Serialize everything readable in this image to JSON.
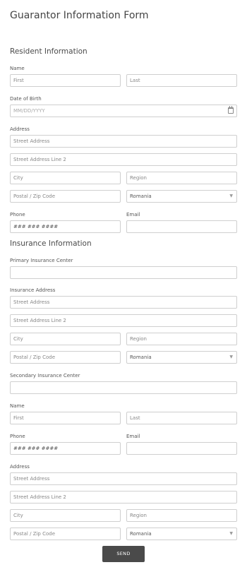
{
  "form": {
    "title": "Guarantor Information Form"
  },
  "resident": {
    "section_title": "Resident Information",
    "name_label": "Name",
    "first_placeholder": "First",
    "last_placeholder": "Last",
    "dob_label": "Date of Birth",
    "dob_placeholder": "MM/DD/YYYY",
    "address_label": "Address",
    "street_placeholder": "Street Address",
    "street2_placeholder": "Street Address Line 2",
    "city_placeholder": "City",
    "region_placeholder": "Region",
    "postal_placeholder": "Postal / Zip Code",
    "country_value": "Romania",
    "phone_label": "Phone",
    "phone_placeholder": "### ### ####",
    "email_label": "Email",
    "email_value": ""
  },
  "insurance": {
    "section_title": "Insurance Information",
    "primary_center_label": "Primary Insurance Center",
    "primary_center_value": "",
    "address_label": "Insurance Address",
    "street_placeholder": "Street Address",
    "street2_placeholder": "Street Address Line 2",
    "city_placeholder": "City",
    "region_placeholder": "Region",
    "postal_placeholder": "Postal / Zip Code",
    "country_value": "Romania",
    "secondary_center_label": "Secondary Insurance Center",
    "secondary_center_value": "",
    "name_label": "Name",
    "first_placeholder": "First",
    "last_placeholder": "Last",
    "phone_label": "Phone",
    "phone_placeholder": "### ### ####",
    "email_label": "Email",
    "email_value": "",
    "address2_label": "Address",
    "street_b_placeholder": "Street Address",
    "street2_b_placeholder": "Street Address Line 2",
    "city_b_placeholder": "City",
    "region_b_placeholder": "Region",
    "postal_b_placeholder": "Postal / Zip Code",
    "country_b_value": "Romania"
  },
  "actions": {
    "send_label": "SEND"
  },
  "icons": {
    "calendar": "calendar-icon",
    "dropdown": "chevron-down-icon"
  }
}
